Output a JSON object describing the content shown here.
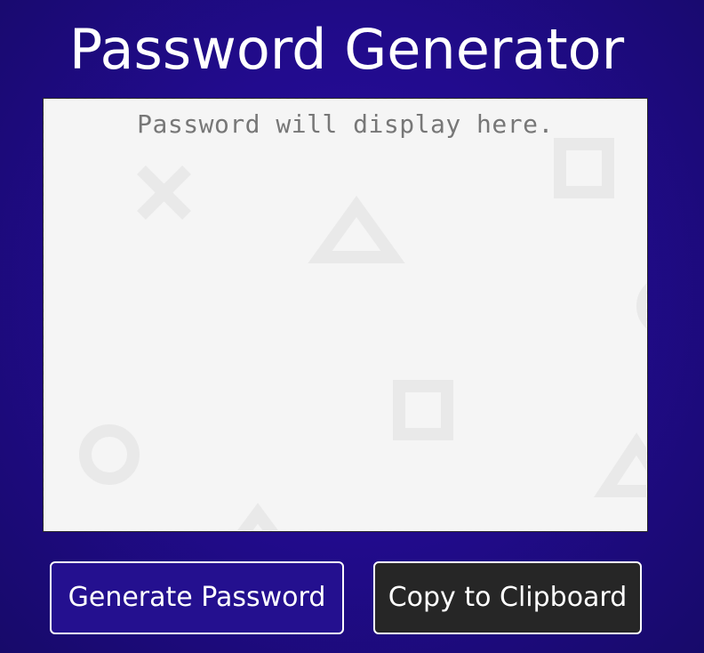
{
  "header": {
    "title": "Password Generator"
  },
  "display": {
    "placeholder": "Password will display here.",
    "background_icons": [
      "cross-icon",
      "triangle-icon",
      "square-icon",
      "circle-icon"
    ]
  },
  "actions": {
    "generate_label": "Generate Password",
    "copy_label": "Copy to Clipboard"
  },
  "colors": {
    "background": "#220b8e",
    "display_background": "#f5f5f5",
    "placeholder_text": "#777777",
    "generate_button": "#24108f",
    "copy_button": "#262626",
    "icon_tint": "#e9e9e9"
  }
}
